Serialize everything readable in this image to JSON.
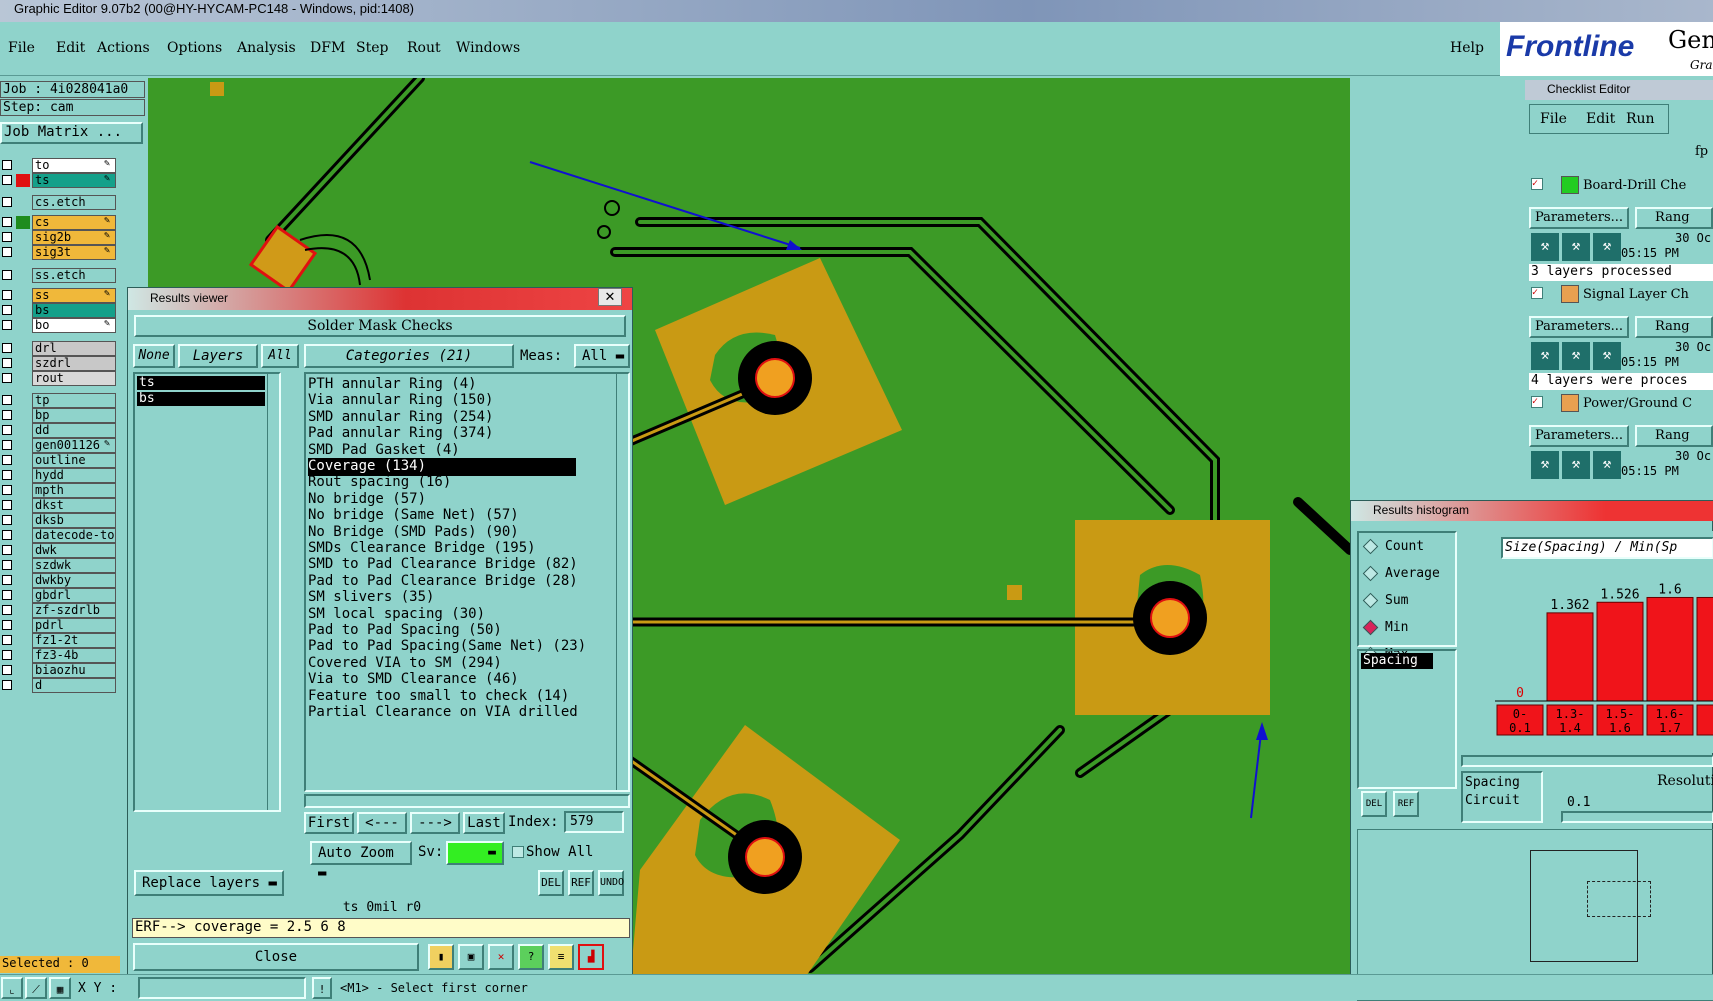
{
  "window": {
    "title": "Graphic Editor 9.07b2 (00@HY-HYCAM-PC148 - Windows, pid:1408)"
  },
  "menu": {
    "items": [
      "File",
      "Edit",
      "Actions",
      "Options",
      "Analysis",
      "DFM",
      "Step",
      "Rout",
      "Windows"
    ],
    "help": "Help"
  },
  "brand": {
    "name": "Frontline",
    "suffix": "Gen",
    "sub": "Gra"
  },
  "job": {
    "job": "Job : 4i028041a0",
    "step": "Step: cam",
    "matrix_btn": "Job Matrix ..."
  },
  "layers": [
    {
      "name": "to",
      "color": "",
      "bg": "#ffffff",
      "mark": "✎"
    },
    {
      "name": "ts",
      "color": "#e01010",
      "bg": "#14a08a",
      "mark": "✎"
    },
    {
      "name": "cs.etch",
      "color": "",
      "bg": "#8fd3cb",
      "mark": ""
    },
    {
      "name": "cs",
      "color": "#1e8c1e",
      "bg": "#f0b83a",
      "mark": "✎"
    },
    {
      "name": "sig2b",
      "color": "",
      "bg": "#f0b83a",
      "mark": "✎"
    },
    {
      "name": "sig3t",
      "color": "",
      "bg": "#f0b83a",
      "mark": "✎"
    },
    {
      "name": "ss.etch",
      "color": "",
      "bg": "#8fd3cb",
      "mark": ""
    },
    {
      "name": "ss",
      "color": "",
      "bg": "#f0b83a",
      "mark": "✎"
    },
    {
      "name": "bs",
      "color": "",
      "bg": "#14a08a",
      "mark": ""
    },
    {
      "name": "bo",
      "color": "",
      "bg": "#ffffff",
      "mark": "✎"
    },
    {
      "name": "drl",
      "color": "",
      "bg": "#c8c8c8",
      "mark": ""
    },
    {
      "name": "szdrl",
      "color": "",
      "bg": "#c8c8c8",
      "mark": ""
    },
    {
      "name": "rout",
      "color": "",
      "bg": "#d8d8d8",
      "mark": ""
    },
    {
      "name": "tp",
      "color": "",
      "bg": "#8fd3cb",
      "mark": ""
    },
    {
      "name": "bp",
      "color": "",
      "bg": "#8fd3cb",
      "mark": ""
    },
    {
      "name": "dd",
      "color": "",
      "bg": "#8fd3cb",
      "mark": ""
    },
    {
      "name": "gen001126",
      "color": "",
      "bg": "#8fd3cb",
      "mark": "✎"
    },
    {
      "name": "outline",
      "color": "",
      "bg": "#8fd3cb",
      "mark": ""
    },
    {
      "name": "hydd",
      "color": "",
      "bg": "#8fd3cb",
      "mark": ""
    },
    {
      "name": "mpth",
      "color": "",
      "bg": "#8fd3cb",
      "mark": ""
    },
    {
      "name": "dkst",
      "color": "",
      "bg": "#8fd3cb",
      "mark": ""
    },
    {
      "name": "dksb",
      "color": "",
      "bg": "#8fd3cb",
      "mark": ""
    },
    {
      "name": "datecode-to",
      "color": "",
      "bg": "#8fd3cb",
      "mark": ""
    },
    {
      "name": "dwk",
      "color": "",
      "bg": "#8fd3cb",
      "mark": ""
    },
    {
      "name": "szdwk",
      "color": "",
      "bg": "#8fd3cb",
      "mark": ""
    },
    {
      "name": "dwkby",
      "color": "",
      "bg": "#8fd3cb",
      "mark": ""
    },
    {
      "name": "gbdrl",
      "color": "",
      "bg": "#8fd3cb",
      "mark": ""
    },
    {
      "name": "zf-szdrlb",
      "color": "",
      "bg": "#8fd3cb",
      "mark": ""
    },
    {
      "name": "pdrl",
      "color": "",
      "bg": "#8fd3cb",
      "mark": ""
    },
    {
      "name": "fz1-2t",
      "color": "",
      "bg": "#8fd3cb",
      "mark": ""
    },
    {
      "name": "fz3-4b",
      "color": "",
      "bg": "#8fd3cb",
      "mark": ""
    },
    {
      "name": "biaozhu",
      "color": "",
      "bg": "#8fd3cb",
      "mark": ""
    },
    {
      "name": "d",
      "color": "",
      "bg": "#8fd3cb",
      "mark": ""
    }
  ],
  "selected": "Selected : 0",
  "results_viewer": {
    "title": "Results viewer",
    "heading": "Solder Mask Checks",
    "btn_none": "None",
    "btn_layers": "Layers",
    "btn_all": "All",
    "categories_label": "Categories (21)",
    "meas_label": "Meas:",
    "meas_value": "All",
    "layers": [
      "ts",
      "bs"
    ],
    "categories": [
      "PTH annular Ring (4)",
      "Via annular Ring (150)",
      "SMD annular Ring (254)",
      "Pad annular Ring (374)",
      "SMD Pad Gasket (4)",
      "Coverage (134)",
      "Rout spacing (16)",
      "No bridge (57)",
      "No bridge (Same Net) (57)",
      "No Bridge (SMD Pads) (90)",
      "SMDs Clearance Bridge (195)",
      "SMD to Pad Clearance Bridge (82)",
      "Pad to Pad Clearance Bridge (28)",
      "SM slivers (35)",
      "SM local spacing (30)",
      "Pad to Pad Spacing (50)",
      "Pad to Pad Spacing(Same Net) (23)",
      "Covered VIA to SM (294)",
      "Via to SMD Clearance (46)",
      "Feature too small to check (14)",
      "Partial Clearance on VIA drilled"
    ],
    "selected_category": "Coverage (134)",
    "nav": {
      "first": "First",
      "prev": "<---",
      "next": "--->",
      "last": "Last",
      "index_label": "Index:",
      "index_value": "579"
    },
    "auto_zoom": "Auto Zoom",
    "sv_label": "Sv:",
    "show_all": "Show All",
    "replace_layers": "Replace layers",
    "icons": {
      "del": "DEL",
      "ref": "REF",
      "undo": "UNDO"
    },
    "info": "ts 0mil  r0",
    "erf": "ERF--> coverage = 2.5 6 8",
    "close": "Close"
  },
  "checklist": {
    "title": "Checklist Editor",
    "menu": [
      "File",
      "Edit",
      "Run"
    ],
    "fp": "fp",
    "items": [
      {
        "name": "Board-Drill Che",
        "params": "Parameters...",
        "range": "Rang",
        "date": "30 Oc",
        "time": "05:15 PM",
        "status": "3 layers processed"
      },
      {
        "name": "Signal Layer Ch",
        "params": "Parameters...",
        "range": "Rang",
        "date": "30 Oc",
        "time": "05:15 PM",
        "status": "4 layers were proces"
      },
      {
        "name": "Power/Ground C",
        "params": "Parameters...",
        "range": "Rang",
        "date": "30 Oc",
        "time": "05:15 PM",
        "status": ""
      }
    ]
  },
  "histogram": {
    "title": "Results histogram",
    "options": [
      "Count",
      "Average",
      "Sum",
      "Min",
      "Max"
    ],
    "selected": "Min",
    "list_item": "Spacing",
    "header": "Size(Spacing) / Min(Sp",
    "icons": {
      "del": "DEL",
      "ref": "REF"
    },
    "res_list": [
      "Spacing",
      "Circuit"
    ],
    "resolution_label": "Resoluti",
    "resolution_value": "0.1",
    "chart_data": {
      "type": "bar",
      "categories": [
        "0-0.1",
        "1.3-1.4",
        "1.5-1.6",
        "1.6-1.7",
        "1"
      ],
      "values": [
        0,
        1.362,
        1.526,
        1.6,
        1.6
      ],
      "value_labels": [
        "0",
        "1.362",
        "1.526",
        "1.6",
        "1."
      ],
      "cat_top": [
        "0-",
        "1.3-",
        "1.5-",
        "1.6-",
        "1"
      ],
      "cat_bottom": [
        "0.1",
        "1.4",
        "1.6",
        "1.7",
        ""
      ]
    }
  },
  "status": {
    "xy_label": "X Y :",
    "prompt": "<M1> - Select first corner"
  }
}
